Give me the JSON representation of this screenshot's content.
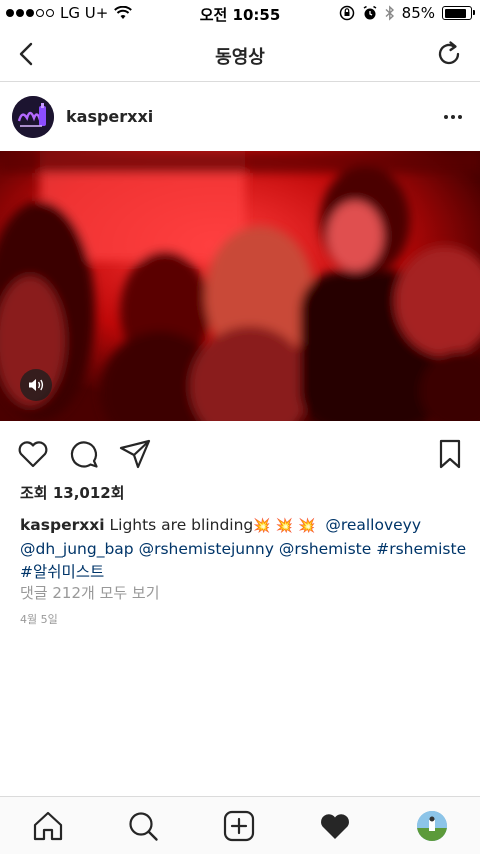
{
  "status_bar": {
    "carrier": "LG U+",
    "time": "오전 10:55",
    "battery_pct": "85%",
    "battery_level": 0.85
  },
  "nav": {
    "title": "동영상",
    "back_icon": "chevron-left-icon",
    "refresh_icon": "refresh-icon"
  },
  "post": {
    "username": "kasperxxi",
    "views_text": "조회 13,012회",
    "caption": {
      "user": "kasperxxi",
      "text": "Lights are blinding",
      "mention_1": "@realloveyy",
      "mention_2": "@dh_jung_bap",
      "mention_3": "@rshemistejunny",
      "mention_4": "@rshemiste",
      "hashtag_1": "#rshemiste",
      "hashtag_2": "#알쉬미스트"
    },
    "comments_link": "댓글 212개 모두 보기",
    "date": "4월 5일"
  },
  "colors": {
    "link": "#003569",
    "meta_gray": "#999999",
    "text": "#262626"
  }
}
